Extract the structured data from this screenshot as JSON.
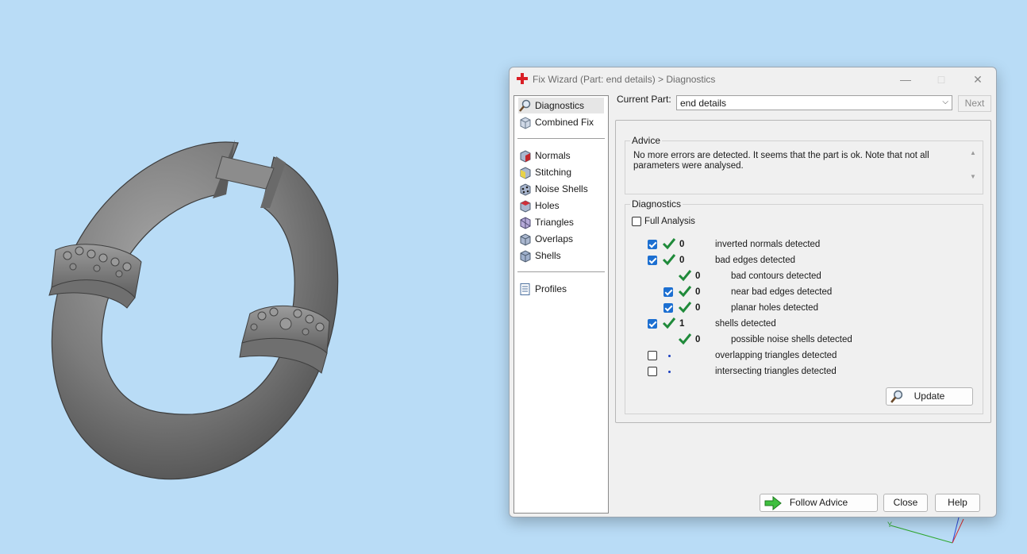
{
  "window": {
    "title": "Fix Wizard (Part: end details) > Diagnostics",
    "minimize_icon": "minimize-icon",
    "maximize_icon": "maximize-icon",
    "close_icon": "close-icon"
  },
  "nav": {
    "top": [
      {
        "label": "Diagnostics",
        "icon": "magnifier-icon",
        "active": true
      },
      {
        "label": "Combined Fix",
        "icon": "cube-icon"
      }
    ],
    "tools": [
      {
        "label": "Normals",
        "icon": "normals-cube-icon"
      },
      {
        "label": "Stitching",
        "icon": "stitching-cube-icon"
      },
      {
        "label": "Noise Shells",
        "icon": "noise-shells-icon"
      },
      {
        "label": "Holes",
        "icon": "holes-cube-icon"
      },
      {
        "label": "Triangles",
        "icon": "triangles-cube-icon"
      },
      {
        "label": "Overlaps",
        "icon": "overlaps-cube-icon"
      },
      {
        "label": "Shells",
        "icon": "shells-cube-icon"
      }
    ],
    "bottom": [
      {
        "label": "Profiles",
        "icon": "document-icon"
      }
    ]
  },
  "current_part": {
    "label": "Current Part:",
    "value": "end details",
    "next_label": "Next"
  },
  "advice": {
    "title": "Advice",
    "text": "No more errors are detected. It seems that the part is ok. Note that not all parameters were analysed."
  },
  "diagnostics": {
    "title": "Diagnostics",
    "full_analysis_label": "Full Analysis",
    "full_analysis_checked": false,
    "rows": [
      {
        "checkbox": true,
        "checked": true,
        "status": "ok",
        "count": "0",
        "label": "inverted normals detected",
        "indent": 0
      },
      {
        "checkbox": true,
        "checked": true,
        "status": "ok",
        "count": "0",
        "label": "bad edges detected",
        "indent": 0
      },
      {
        "checkbox": false,
        "checked": false,
        "status": "ok",
        "count": "0",
        "label": "bad contours detected",
        "indent": 1
      },
      {
        "checkbox": true,
        "checked": true,
        "status": "ok",
        "count": "0",
        "label": "near bad edges detected",
        "indent": 1
      },
      {
        "checkbox": true,
        "checked": true,
        "status": "ok",
        "count": "0",
        "label": "planar holes detected",
        "indent": 1
      },
      {
        "checkbox": true,
        "checked": true,
        "status": "ok",
        "count": "1",
        "label": "shells detected",
        "indent": 0
      },
      {
        "checkbox": false,
        "checked": false,
        "status": "ok",
        "count": "0",
        "label": "possible noise shells detected",
        "indent": 1
      },
      {
        "checkbox": true,
        "checked": false,
        "status": "pending",
        "count": "",
        "label": "overlapping triangles detected",
        "indent": 0
      },
      {
        "checkbox": true,
        "checked": false,
        "status": "pending",
        "count": "",
        "label": "intersecting triangles detected",
        "indent": 0
      }
    ],
    "update_label": "Update"
  },
  "footer": {
    "follow_advice_label": "Follow Advice",
    "close_label": "Close",
    "help_label": "Help"
  },
  "colors": {
    "background": "#b9dcf6",
    "model_gray": "#7a7a7a",
    "check_green": "#1f8a3a",
    "checkbox_blue": "#1c6fd1"
  }
}
